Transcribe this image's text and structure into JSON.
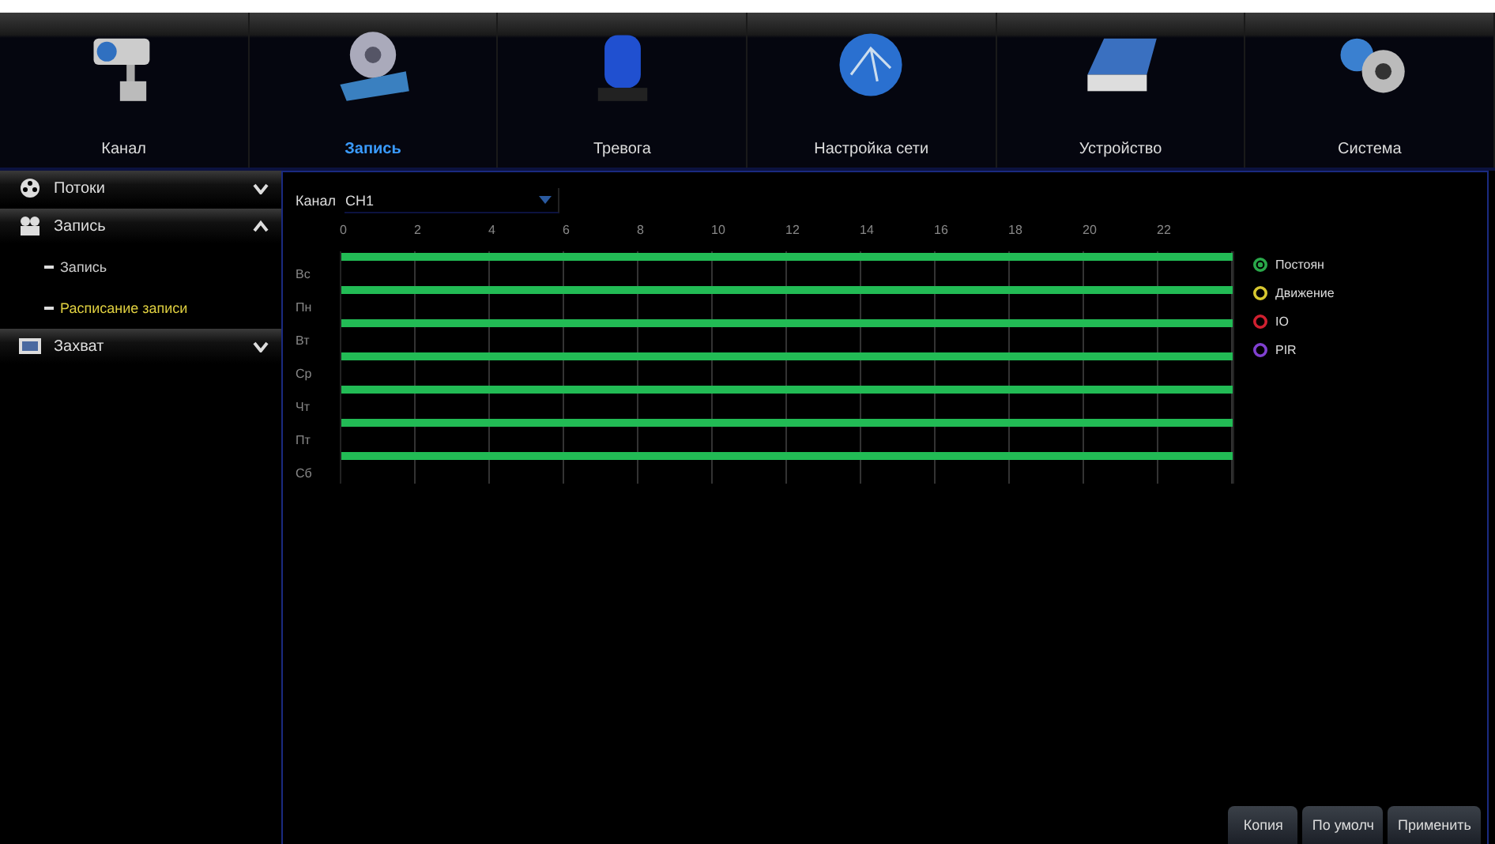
{
  "tabs": [
    {
      "label": "Канал",
      "kind": "camera",
      "selected": false
    },
    {
      "label": "Запись",
      "kind": "film",
      "selected": true
    },
    {
      "label": "Тревога",
      "kind": "alarm",
      "selected": false
    },
    {
      "label": "Настройка сети",
      "kind": "network",
      "selected": false
    },
    {
      "label": "Устройство",
      "kind": "disk",
      "selected": false
    },
    {
      "label": "Система",
      "kind": "gears",
      "selected": false
    }
  ],
  "sidebar": {
    "items": [
      {
        "label": "Потоки",
        "kind": "film",
        "expanded": false
      },
      {
        "label": "Запись",
        "kind": "projector",
        "expanded": true,
        "children": [
          {
            "label": "Запись",
            "selected": false
          },
          {
            "label": "Расписание записи",
            "selected": true
          }
        ]
      },
      {
        "label": "Захват",
        "kind": "picture",
        "expanded": false
      }
    ]
  },
  "channel": {
    "label": "Канал",
    "value": "CH1"
  },
  "schedule": {
    "hours": [
      "0",
      "2",
      "4",
      "6",
      "8",
      "10",
      "12",
      "14",
      "16",
      "18",
      "20",
      "22"
    ],
    "days": [
      {
        "label": "Вс",
        "level": 1
      },
      {
        "label": "Пн",
        "level": 1
      },
      {
        "label": "Вт",
        "level": 1
      },
      {
        "label": "Ср",
        "level": 1
      },
      {
        "label": "Чт",
        "level": 1
      },
      {
        "label": "Пт",
        "level": 1
      },
      {
        "label": "Сб",
        "level": 1
      }
    ]
  },
  "legend": [
    {
      "label": "Постоян",
      "color": "#2aa84a",
      "selected": true
    },
    {
      "label": "Движение",
      "color": "#d8c830",
      "selected": false
    },
    {
      "label": "IO",
      "color": "#d02030",
      "selected": false
    },
    {
      "label": "PIR",
      "color": "#8040d0",
      "selected": false
    }
  ],
  "buttons": [
    "Копия",
    "По умолч",
    "Применить"
  ]
}
